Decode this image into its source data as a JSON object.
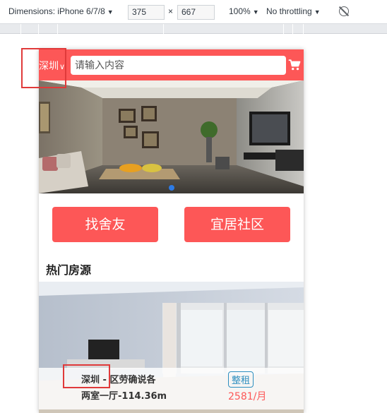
{
  "devtools": {
    "dimensions_label": "Dimensions: iPhone 6/7/8",
    "width": "375",
    "height": "667",
    "times": "×",
    "zoom": "100%",
    "throttle": "No throttling"
  },
  "header": {
    "city": "深圳",
    "search_placeholder": "请输入内容",
    "cart_icon": "cart-icon"
  },
  "banner": {
    "active_dot": 1,
    "dot_count": 1
  },
  "nav": {
    "buttons": [
      {
        "label": "找舍友"
      },
      {
        "label": "宜居社区"
      }
    ]
  },
  "section": {
    "title": "热门房源"
  },
  "listing": {
    "title": "深圳 - 区劳确说各",
    "subtitle": "两室一厅-114.36m",
    "tag": "整租",
    "price": "2581/月"
  },
  "colors": {
    "brand": "#fd5757",
    "tag": "#2d8fc0",
    "annotation": "#e03a3a",
    "dot": "#2d7be5"
  }
}
